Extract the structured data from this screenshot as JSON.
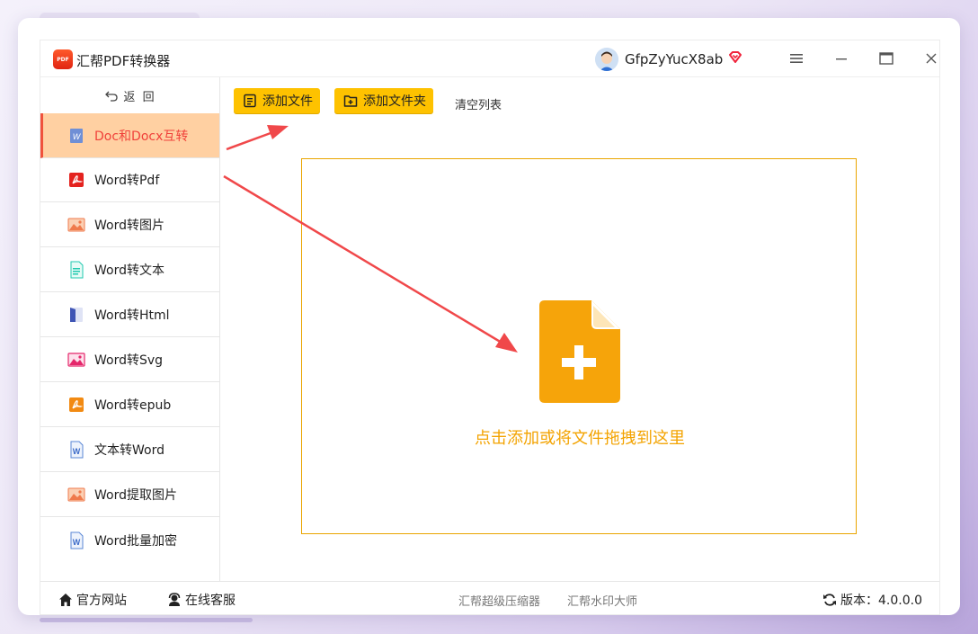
{
  "app": {
    "title": "汇帮PDF转换器",
    "logo_text": "PDF"
  },
  "user": {
    "name": "GfpZyYucX8ab"
  },
  "sidebar": {
    "back_label": "返  回",
    "items": [
      {
        "label": "Doc和Docx互转",
        "icon": "word-doc-icon",
        "active": true
      },
      {
        "label": "Word转Pdf",
        "icon": "pdf-icon"
      },
      {
        "label": "Word转图片",
        "icon": "image-icon"
      },
      {
        "label": "Word转文本",
        "icon": "text-file-icon"
      },
      {
        "label": "Word转Html",
        "icon": "html-icon"
      },
      {
        "label": "Word转Svg",
        "icon": "svg-image-icon"
      },
      {
        "label": "Word转epub",
        "icon": "epub-icon"
      },
      {
        "label": "文本转Word",
        "icon": "word-icon"
      },
      {
        "label": "Word提取图片",
        "icon": "image-icon"
      },
      {
        "label": "Word批量加密",
        "icon": "word-icon"
      }
    ]
  },
  "toolbar": {
    "add_file": "添加文件",
    "add_folder": "添加文件夹",
    "clear_list": "清空列表"
  },
  "dropzone": {
    "text": "点击添加或将文件拖拽到这里"
  },
  "footer": {
    "website": "官方网站",
    "support": "在线客服",
    "link1": "汇帮超级压缩器",
    "link2": "汇帮水印大师",
    "version": "版本：4.0.0.0"
  },
  "colors": {
    "accent": "#fec200",
    "active_bg": "#ffd0a2",
    "active_text": "#f0413a",
    "arrow": "#f0484a",
    "drop_border": "#eaa500"
  }
}
